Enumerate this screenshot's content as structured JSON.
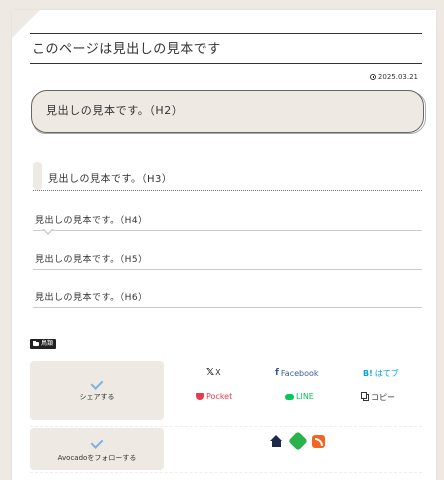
{
  "article": {
    "title": "このページは見出しの見本です",
    "date": "2025.03.21",
    "headings": {
      "h2": "見出しの見本です。（H2）",
      "h3": "見出しの見本です。（H3）",
      "h4": "見出しの見本です。（H4）",
      "h5": "見出しの見本です。（H5）",
      "h6": "見出しの見本です。（H6）"
    },
    "category": "鳥類"
  },
  "share": {
    "label": "シェアする",
    "buttons": {
      "x": "X",
      "facebook": "Facebook",
      "hatena": "はてブ",
      "pocket": "Pocket",
      "line": "LINE",
      "copy": "コピー"
    }
  },
  "follow": {
    "label": "Avocadoをフォローする",
    "icons": [
      "home-icon",
      "feedly-icon",
      "rss-icon"
    ]
  },
  "colors": {
    "background": "#efe9e4",
    "facebook": "#3b5998",
    "hatena": "#00a4de",
    "pocket": "#e8394d",
    "line": "#06c755",
    "rss": "#f26522",
    "feedly": "#2bb24c",
    "home": "#1e2a4a",
    "check": "#7eb0e0"
  }
}
